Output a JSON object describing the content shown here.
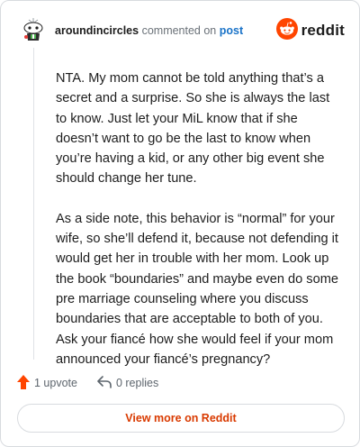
{
  "header": {
    "username": "aroundincircles",
    "commented_text": "commented on",
    "post_link": "post",
    "brand": "reddit"
  },
  "comment": {
    "paragraphs": [
      "NTA. My mom cannot be told anything that’s a secret and a surprise. So she is always the last to know. Just let your MiL know that if she doesn’t want to go be the last to know when you’re having a kid, or any other big event she should change her tune.",
      "As a side note, this behavior is “normal” for your wife, so she’ll defend it, because not defending it would get her in trouble with her mom. Look up the book “boundaries” and maybe even do some pre marriage counseling where you discuss boundaries that are acceptable to both of you. Ask your fiancé how she would feel if your mom announced your fiancé’s pregnancy?"
    ]
  },
  "actions": {
    "upvotes": "1 upvote",
    "replies": "0 replies"
  },
  "footer": {
    "view_more": "View more on Reddit"
  },
  "colors": {
    "reddit_orange": "#ff4500",
    "link_blue": "#1a73c8",
    "view_more_text": "#d93a00"
  },
  "icons": {
    "avatar": "snoo-avatar-icon",
    "brand": "reddit-logo-icon",
    "upvote": "upvote-arrow-icon",
    "reply": "reply-arrow-icon"
  }
}
